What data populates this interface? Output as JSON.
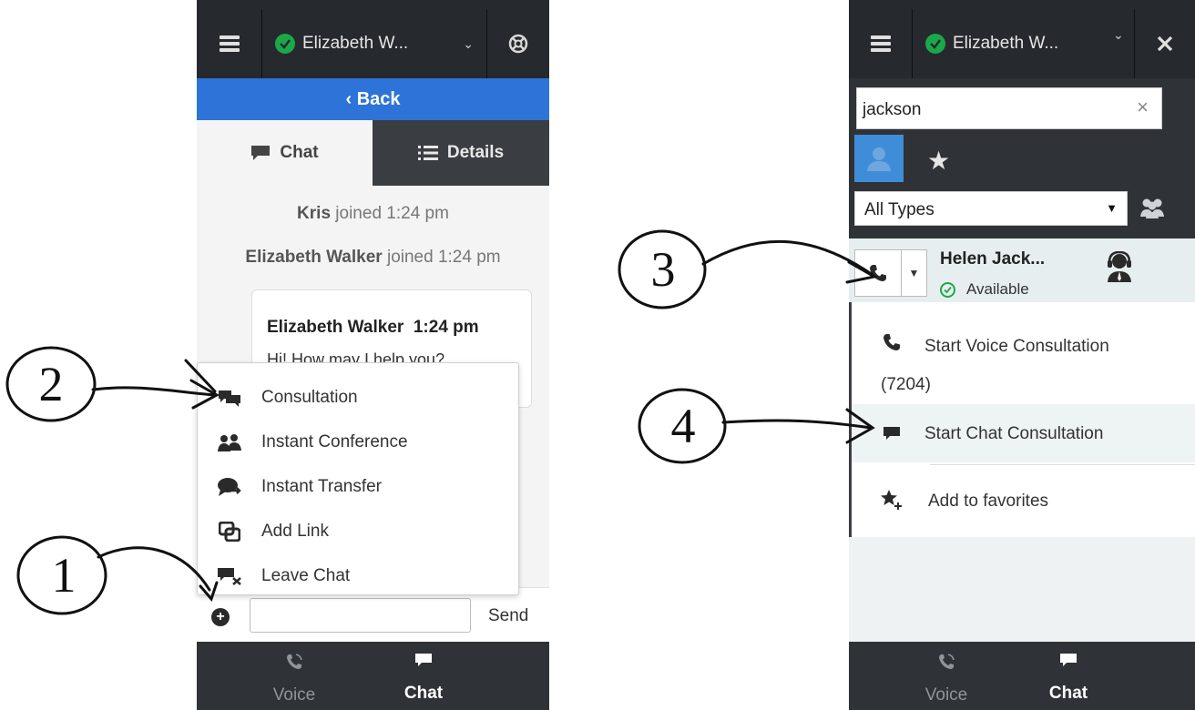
{
  "left": {
    "agent_name": "Elizabeth W...",
    "back_label": "‹ Back",
    "tabs": [
      {
        "label": "Chat"
      },
      {
        "label": "Details"
      }
    ],
    "system_messages": [
      {
        "name": "Kris",
        "text": " joined 1:24 pm"
      },
      {
        "name": "Elizabeth Walker",
        "text": " joined 1:24 pm"
      }
    ],
    "bubble": {
      "sender": "Elizabeth Walker",
      "time": "1:24 pm",
      "text": "Hi! How may I help you?"
    },
    "menu_items": [
      {
        "label": "Consultation",
        "icon": "consultation-icon"
      },
      {
        "label": "Instant Conference",
        "icon": "conference-icon"
      },
      {
        "label": "Instant Transfer",
        "icon": "transfer-icon"
      },
      {
        "label": "Add Link",
        "icon": "link-icon"
      },
      {
        "label": "Leave Chat",
        "icon": "leave-chat-icon"
      }
    ],
    "send_label": "Send",
    "bottom_tabs": [
      {
        "label": "Voice"
      },
      {
        "label": "Chat"
      }
    ]
  },
  "right": {
    "agent_name": "Elizabeth W...",
    "search_value": "jackson",
    "type_filter": "All Types",
    "contact": {
      "name": "Helen Jack...",
      "status": "Available"
    },
    "context_menu": [
      {
        "label": "Start Voice Consultation",
        "sub": "(7204)",
        "icon": "phone-icon"
      },
      {
        "label": "Start Chat Consultation",
        "icon": "chat-bubble-icon"
      },
      {
        "label": "Add to favorites",
        "icon": "add-favorite-icon"
      }
    ],
    "bottom_tabs": [
      {
        "label": "Voice"
      },
      {
        "label": "Chat"
      }
    ]
  },
  "annotations": [
    "1",
    "2",
    "3",
    "4"
  ],
  "colors": {
    "status_green": "#1aa84a",
    "back_blue": "#2d73d8",
    "dark_bar": "#26292d"
  }
}
